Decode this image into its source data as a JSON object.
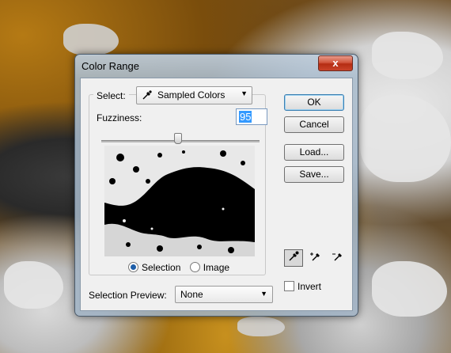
{
  "dialog": {
    "title": "Color Range",
    "close_label": "x"
  },
  "select": {
    "label": "Select:",
    "value": "Sampled Colors"
  },
  "fuzziness": {
    "label": "Fuzziness:",
    "value": "95",
    "slider_fraction": 0.48
  },
  "view": {
    "selection_label": "Selection",
    "image_label": "Image",
    "selected": "Selection"
  },
  "buttons": {
    "ok": "OK",
    "cancel": "Cancel",
    "load": "Load...",
    "save": "Save..."
  },
  "tools": [
    "eyedropper-icon",
    "eyedropper-plus-icon",
    "eyedropper-minus-icon"
  ],
  "invert": {
    "label": "Invert",
    "checked": false
  },
  "selection_preview": {
    "label": "Selection Preview:",
    "value": "None"
  },
  "colors": {
    "close_button": "#c9442a",
    "radio_selected": "#1c5da8",
    "text_highlight": "#3399ff",
    "default_button_border": "#3c7fb1"
  }
}
